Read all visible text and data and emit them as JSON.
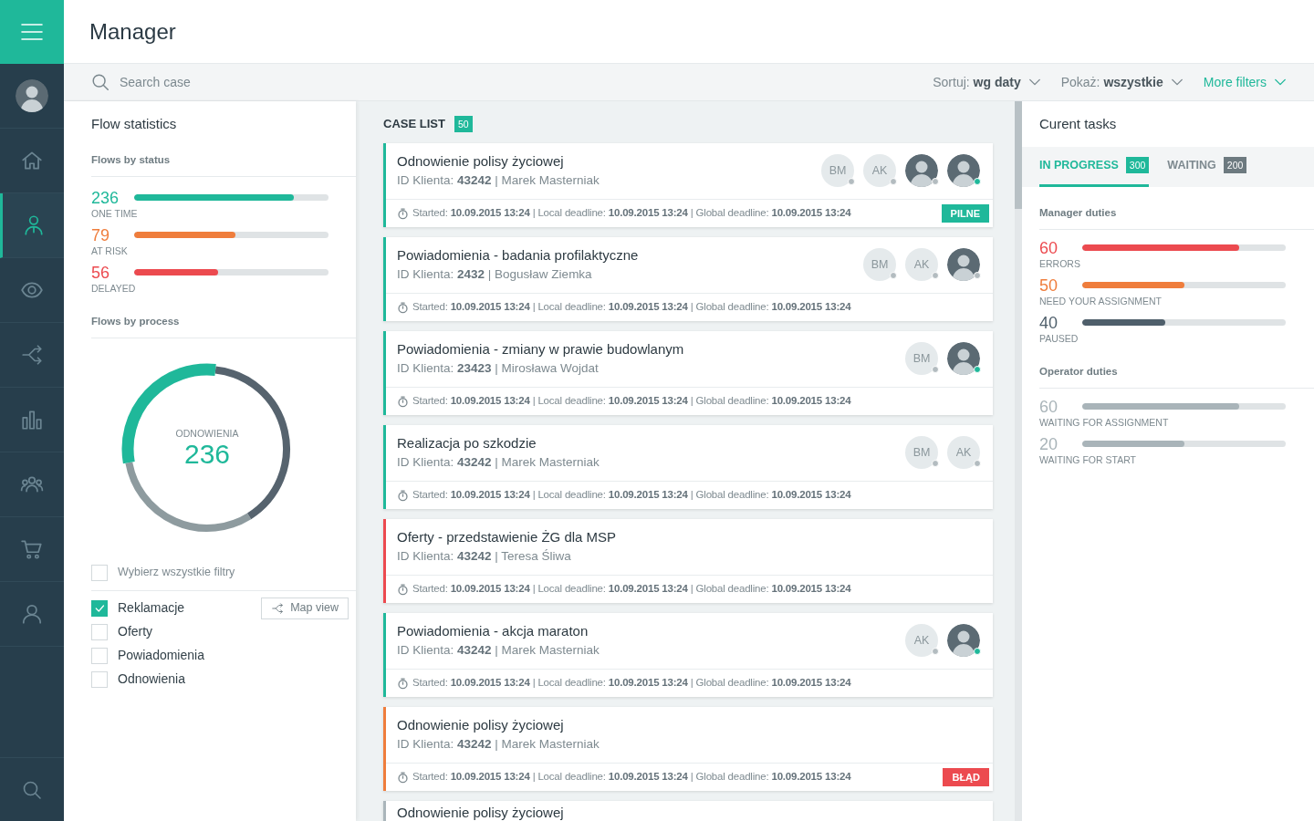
{
  "sidebar": {
    "user": {
      "kind": "photo"
    },
    "items": [
      {
        "kind": "home",
        "selected": false
      },
      {
        "kind": "manager",
        "selected": true
      },
      {
        "kind": "eye",
        "selected": false
      },
      {
        "kind": "flow",
        "selected": false
      },
      {
        "kind": "chart",
        "selected": false
      },
      {
        "kind": "group",
        "selected": false
      },
      {
        "kind": "cart",
        "selected": false
      },
      {
        "kind": "user",
        "selected": false
      }
    ],
    "bottom": {
      "kind": "search"
    }
  },
  "header": {
    "title": "Manager"
  },
  "toolbar": {
    "search": {
      "placeholder": "Search case"
    },
    "filters": [
      {
        "kind": "select",
        "text": "Sortuj: **wg daty**"
      },
      {
        "kind": "select",
        "text": "Pokaż: **wszystkie**"
      },
      {
        "kind": "link",
        "text": "More filters"
      }
    ]
  },
  "flow_statistics": {
    "title": "Flow statistics",
    "status_heading": "Flows by status",
    "status": [
      {
        "value": "236",
        "label": "ONE TIME",
        "level": 0.82,
        "color": "#1fb89a"
      },
      {
        "value": "79",
        "label": "AT RISK",
        "level": 0.52,
        "color": "#ef7d3c"
      },
      {
        "value": "56",
        "label": "DELAYED",
        "level": 0.43,
        "color": "#ec4a4f"
      }
    ],
    "process_heading": "Flows by process",
    "donut": {
      "label": "ODNOWIENIA",
      "value": "236"
    },
    "select_all": {
      "label": "Wybierz wszystkie filtry",
      "checked": false
    },
    "filters": [
      {
        "label": "Reklamacje",
        "checked": true
      },
      {
        "label": "Oferty",
        "checked": false
      },
      {
        "label": "Powiadomienia",
        "checked": false
      },
      {
        "label": "Odnowienia",
        "checked": false
      }
    ],
    "map_button": "Map view"
  },
  "case_list": {
    "title": "CASE LIST",
    "count": "50",
    "cases": [
      {
        "title": "Odnowienie polisy życiowej",
        "client": "ID Klienta: **43242** | Marek Masterniak",
        "color": "#1fb89a",
        "avatars": [
          {
            "kind": "initials",
            "text": "BM",
            "online": false
          },
          {
            "kind": "initials",
            "text": "AK",
            "online": false
          },
          {
            "kind": "photo",
            "online": false
          },
          {
            "kind": "photo",
            "online": true
          }
        ],
        "meta": "Started: **10.09.2015 13:24** | Local deadline: **10.09.2015 13:24** | Global deadline: **10.09.2015 13:24**",
        "tag": {
          "kind": "urgent",
          "text": "PILNE"
        }
      },
      {
        "title": "Powiadomienia - badania profilaktyczne",
        "client": "ID Klienta: **2432** | Bogusław Ziemka",
        "color": "#1fb89a",
        "avatars": [
          {
            "kind": "initials",
            "text": "BM",
            "online": false
          },
          {
            "kind": "initials",
            "text": "AK",
            "online": false
          },
          {
            "kind": "photo",
            "online": false
          }
        ],
        "meta": "Started: **10.09.2015 13:24** | Local deadline: **10.09.2015 13:24** | Global deadline: **10.09.2015 13:24**"
      },
      {
        "title": "Powiadomienia - zmiany w prawie budowlanym",
        "client": "ID Klienta: **23423** | Mirosława Wojdat",
        "color": "#1fb89a",
        "avatars": [
          {
            "kind": "initials",
            "text": "BM",
            "online": false
          },
          {
            "kind": "photo",
            "online": true
          }
        ],
        "meta": "Started: **10.09.2015 13:24** | Local deadline: **10.09.2015 13:24** | Global deadline: **10.09.2015 13:24**"
      },
      {
        "title": "Realizacja po szkodzie",
        "client": "ID Klienta: **43242** | Marek Masterniak",
        "color": "#1fb89a",
        "avatars": [
          {
            "kind": "initials",
            "text": "BM",
            "online": false
          },
          {
            "kind": "initials",
            "text": "AK",
            "online": false
          }
        ],
        "meta": "Started: **10.09.2015 13:24** | Local deadline: **10.09.2015 13:24** | Global deadline: **10.09.2015 13:24**"
      },
      {
        "title": "Oferty - przedstawienie ŻG dla MSP",
        "client": "ID Klienta: **43242** | Teresa Śliwa",
        "color": "#ec4a4f",
        "meta": "Started: **10.09.2015 13:24** | Local deadline: **10.09.2015 13:24** | Global deadline: **10.09.2015 13:24**"
      },
      {
        "title": "Powiadomienia - akcja maraton",
        "client": "ID Klienta: **43242** | Marek Masterniak",
        "color": "#1fb89a",
        "avatars": [
          {
            "kind": "initials",
            "text": "AK",
            "online": false
          },
          {
            "kind": "photo",
            "online": true
          }
        ],
        "meta": "Started: **10.09.2015 13:24** | Local deadline: **10.09.2015 13:24** | Global deadline: **10.09.2015 13:24**"
      },
      {
        "title": "Odnowienie polisy życiowej",
        "client": "ID Klienta: **43242** | Marek Masterniak",
        "color": "#ef7d3c",
        "meta": "Started: **10.09.2015 13:24** | Local deadline: **10.09.2015 13:24** | Global deadline: **10.09.2015 13:24**",
        "tag": {
          "kind": "error",
          "text": "BŁĄD"
        }
      },
      {
        "title": "Odnowienie polisy życiowej",
        "color": "#aab5ba"
      }
    ]
  },
  "current_tasks": {
    "title": "Curent tasks",
    "tabs": [
      {
        "label": "IN PROGRESS",
        "count": "300",
        "selected": true
      },
      {
        "label": "WAITING",
        "count": "200",
        "selected": false
      }
    ],
    "groups": [
      {
        "heading": "Manager duties",
        "items": [
          {
            "value": "60",
            "label": "ERRORS",
            "level": 0.77,
            "color": "#ec4a4f"
          },
          {
            "value": "50",
            "label": "NEED YOUR ASSIGNMENT",
            "level": 0.5,
            "color": "#ef7d3c"
          },
          {
            "value": "40",
            "label": "PAUSED",
            "level": 0.41,
            "color": "#4f5f6b"
          }
        ]
      },
      {
        "heading": "Operator duties",
        "items": [
          {
            "value": "60",
            "label": "WAITING FOR ASSIGNMENT",
            "level": 0.77,
            "color": "#a9b4b9"
          },
          {
            "value": "20",
            "label": "WAITING FOR START",
            "level": 0.5,
            "color": "#a9b4b9"
          }
        ]
      }
    ]
  }
}
